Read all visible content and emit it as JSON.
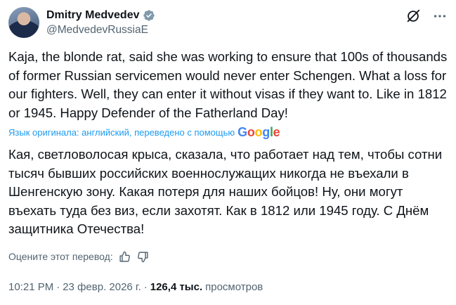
{
  "author": {
    "name": "Dmitry Medvedev",
    "handle": "@MedvedevRussiaE"
  },
  "tweet": {
    "text": "Kaja, the blonde rat, said she was working to ensure that 100s of thousands of former Russian servicemen would never enter Schengen. What a loss for our fighters. Well, they can enter it without visas if they want to. Like in 1812 or 1945. Happy Defender of the Fatherland Day!"
  },
  "translation": {
    "label": "Язык оригинала: английский, переведено с помощью",
    "provider": "Google",
    "text": "Кая, светловолосая крыса, сказала, что работает над тем, чтобы сотни тысяч бывших российских военнослужащих никогда не въехали в Шенгенскую зону. Какая потеря для наших бойцов! Ну, они могут въехать туда без виз, если захотят. Как в 1812 или 1945 году. С Днём защитника Отечества!",
    "rate_label": "Оцените этот перевод:"
  },
  "meta": {
    "time": "10:21 PM",
    "date": "23 февр. 2026 г.",
    "views_count": "126,4 тыс.",
    "views_label": "просмотров",
    "separator": "·"
  },
  "icons": [
    "verified-badge-icon",
    "grok-icon",
    "more-icon",
    "thumbs-up-icon",
    "thumbs-down-icon"
  ],
  "colors": {
    "accent": "#1d9bf0",
    "text": "#0f1419",
    "secondary": "#536471",
    "verified": "#829aab"
  }
}
